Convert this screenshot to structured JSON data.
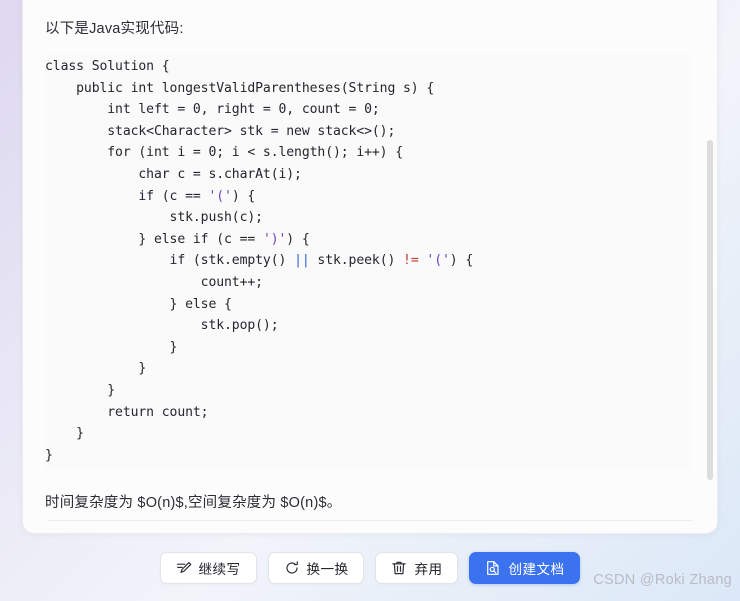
{
  "message": {
    "intro": "以下是Java实现代码:",
    "complexity": "时间复杂度为 $O(n)$,空间复杂度为 $O(n)$。"
  },
  "code": {
    "language": "java",
    "lines": [
      "class Solution {",
      "    public int longestValidParentheses(String s) {",
      "        int left = 0, right = 0, count = 0;",
      "        stack<Character> stk = new stack<>();",
      "        for (int i = 0; i < s.length(); i++) {",
      "            char c = s.charAt(i);",
      "            if (c == '(') {",
      "                stk.push(c);",
      "            } else if (c == ')') {",
      "                if (stk.empty() || stk.peek() != '(') {",
      "                    count++;",
      "                } else {",
      "                    stk.pop();",
      "                }",
      "            }",
      "        }",
      "        return count;",
      "    }",
      "}"
    ]
  },
  "actions": {
    "continue_label": "继续写",
    "regenerate_label": "换一换",
    "discard_label": "弃用",
    "create_doc_label": "创建文档"
  },
  "icons": {
    "continue": "pencil-write-icon",
    "regenerate": "refresh-circle-icon",
    "discard": "trash-icon",
    "create_doc": "document-search-icon"
  },
  "watermark": {
    "text": "CSDN @Roki Zhang"
  },
  "colors": {
    "primary": "#3b72f0",
    "card_background": "#fcfcfd",
    "code_background": "#fafafb",
    "text": "#24262c",
    "operator_blue": "#2b5fd9",
    "operator_red": "#c0392b",
    "string_purple": "#6f42c1",
    "watermark": "#b9bcc4"
  }
}
